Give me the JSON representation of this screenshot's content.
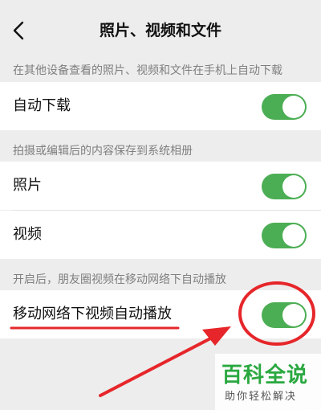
{
  "header": {
    "title": "照片、视频和文件",
    "back_icon": "chevron-left-icon"
  },
  "sections": [
    {
      "caption": "在其他设备查看的照片、视频和文件在手机上自动下载",
      "items": [
        {
          "label": "自动下载",
          "enabled": true
        }
      ]
    },
    {
      "caption": "拍摄或编辑后的内容保存到系统相册",
      "items": [
        {
          "label": "照片",
          "enabled": true
        },
        {
          "label": "视频",
          "enabled": true
        }
      ]
    },
    {
      "caption": "开启后，朋友圈视频在移动网络下自动播放",
      "items": [
        {
          "label": "移动网络下视频自动播放",
          "enabled": true
        }
      ]
    }
  ],
  "colors": {
    "toggle_on": "#4cae54",
    "annotation_red": "#e6262a",
    "watermark_green": "#2aa840"
  },
  "watermark": {
    "main": "百科全说",
    "sub": "助你轻松解决"
  }
}
